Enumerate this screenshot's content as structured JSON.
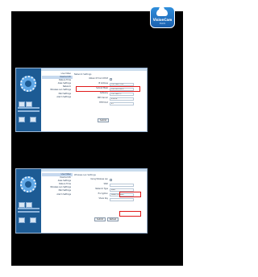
{
  "logo": {
    "name": "VisionCam",
    "sub": "PLUS",
    "color": "#2f8fdc"
  },
  "colors": {
    "frame": "#000000",
    "sidebar": "#1d5b94",
    "highlight": "#e01a1a"
  },
  "screens": [
    {
      "menu": [
        "Live Video",
        "Device Info",
        "Date & Time",
        "Alias Settings",
        "Network",
        "Wireless Lan Settings",
        "Mail Settings",
        "Alarm Settings"
      ],
      "active_menu": 1,
      "title": "Network Settings",
      "rows": [
        {
          "label": "Obtain IP from DHCP",
          "kind": "check"
        },
        {
          "label": "IP Address",
          "value": "192.168.1.100"
        },
        {
          "label": "Subnet Mask",
          "value": "255.255.255.0"
        },
        {
          "label": "Gateway",
          "value": "192.168.1.1"
        },
        {
          "label": "DNS Server",
          "value": "8.8.8.8"
        },
        {
          "label": "HTTP Port",
          "value": "81"
        }
      ],
      "button": "Submit"
    },
    {
      "menu": [
        "Live Video",
        "Device Info",
        "Alias Settings",
        "Date & Time",
        "Wireless Lan Settings",
        "Mail Settings",
        "Alarm Settings"
      ],
      "active_menu": 0,
      "title": "Wireless Lan Settings",
      "rows": [
        {
          "label": "Using Wireless Lan",
          "kind": "check"
        },
        {
          "label": "SSID",
          "value": ""
        },
        {
          "label": "Network Type",
          "value": "Infra"
        },
        {
          "label": "Encryption",
          "value": "WPA2 Personal"
        },
        {
          "label": "Share Key",
          "value": ""
        }
      ],
      "button": "Submit",
      "button2": "Refresh"
    }
  ]
}
